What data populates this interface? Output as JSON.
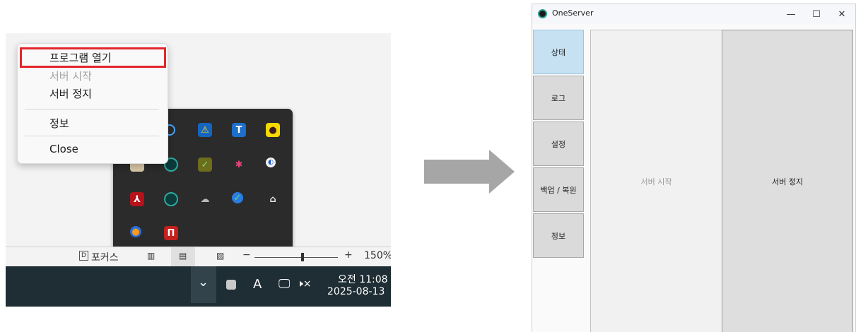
{
  "context_menu": {
    "items": [
      {
        "label": "프로그램 열기",
        "enabled": true
      },
      {
        "label": "서버 시작",
        "enabled": false
      },
      {
        "label": "서버 정지",
        "enabled": true
      },
      {
        "label": "정보",
        "enabled": true
      },
      {
        "label": "Close",
        "enabled": true
      }
    ],
    "highlight_color": "#e3262a"
  },
  "status_bar": {
    "focus_label": "포커스",
    "zoom_minus": "−",
    "zoom_plus": "+",
    "zoom_level": "150%"
  },
  "taskbar": {
    "chevron": "⌄",
    "ime_label": "A",
    "volume": "🕨×",
    "time": "오전 11:08",
    "date": "2025-08-13",
    "background": "#1f2d34"
  },
  "app_window": {
    "title": "OneServer",
    "controls": {
      "minimize": "—",
      "maximize": "☐",
      "close": "✕"
    },
    "nav": [
      {
        "label": "상태",
        "active": true
      },
      {
        "label": "로그",
        "active": false
      },
      {
        "label": "설정",
        "active": false
      },
      {
        "label": "백업 / 복원",
        "active": false
      },
      {
        "label": "정보",
        "active": false
      }
    ],
    "start_button": "서버 시작",
    "stop_button": "서버 정지",
    "accent_color": "#c6e1f2"
  }
}
